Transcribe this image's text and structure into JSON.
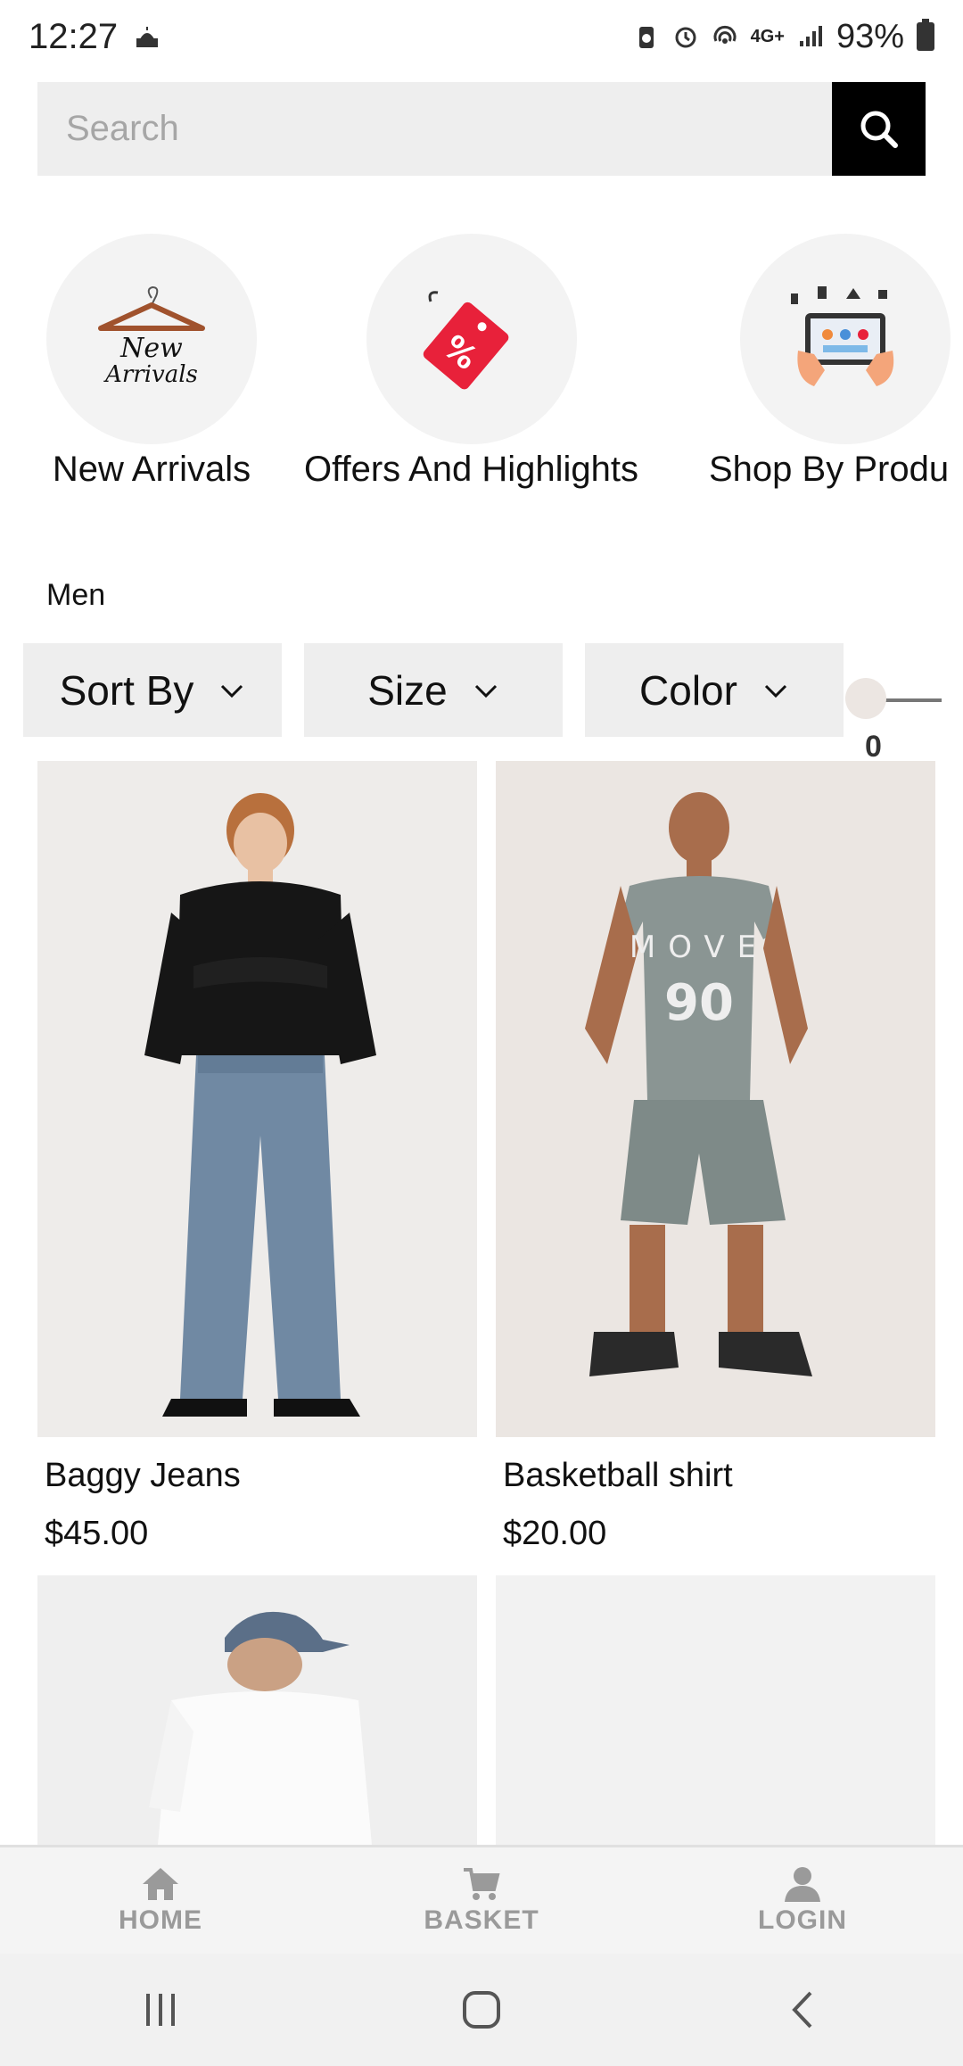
{
  "status_bar": {
    "time": "12:27",
    "network": "4G+",
    "battery_percent": "93%"
  },
  "search": {
    "placeholder": "Search"
  },
  "categories": [
    {
      "label": "New Arrivals",
      "icon": "hanger-icon"
    },
    {
      "label": "Offers And Highlights",
      "icon": "discount-tag-icon"
    },
    {
      "label": "Shop By Produ",
      "icon": "tablet-shopping-icon"
    }
  ],
  "section_title": "Men",
  "filters": [
    {
      "label": "Sort By"
    },
    {
      "label": "Size"
    },
    {
      "label": "Color"
    }
  ],
  "slider": {
    "value": "0"
  },
  "products": [
    {
      "name": "Baggy Jeans",
      "price": "$45.00"
    },
    {
      "name": "Basketball shirt",
      "price": "$20.00"
    }
  ],
  "bottom_nav": [
    {
      "label": "HOME",
      "icon": "home-icon"
    },
    {
      "label": "BASKET",
      "icon": "cart-icon"
    },
    {
      "label": "LOGIN",
      "icon": "user-icon"
    }
  ],
  "colors": {
    "accent": "#000000",
    "offer_tag": "#e8213a",
    "nav_label": "#9a9a9a"
  }
}
